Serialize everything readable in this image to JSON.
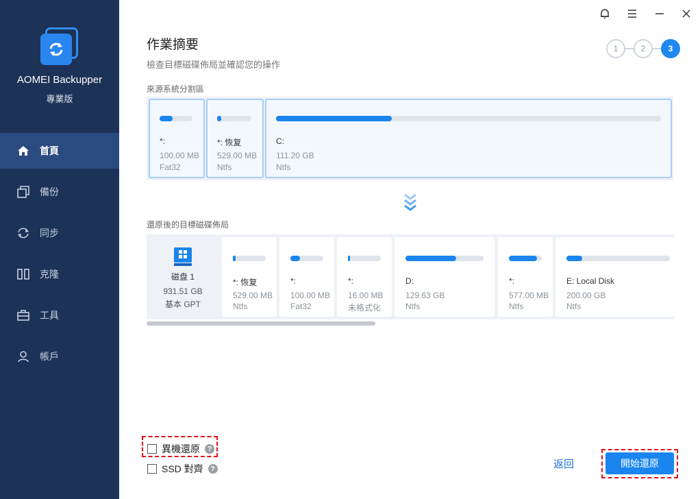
{
  "app": {
    "name": "AOMEI Backupper",
    "edition": "專業版"
  },
  "sidebar": {
    "items": [
      {
        "label": "首頁",
        "icon": "home-icon",
        "active": true
      },
      {
        "label": "備份",
        "icon": "backup-icon",
        "active": false
      },
      {
        "label": "同步",
        "icon": "sync-icon",
        "active": false
      },
      {
        "label": "克隆",
        "icon": "clone-icon",
        "active": false
      },
      {
        "label": "工具",
        "icon": "toolbox-icon",
        "active": false
      },
      {
        "label": "帳戶",
        "icon": "user-icon",
        "active": false
      }
    ]
  },
  "window_controls": [
    "bell-icon",
    "menu-icon",
    "minimize-icon",
    "close-icon"
  ],
  "page": {
    "title": "作業摘要",
    "subtitle": "檢查目標磁碟佈局並確認您的操作"
  },
  "steps": [
    "1",
    "2",
    "3"
  ],
  "active_step": 3,
  "source": {
    "label": "來源系統分割區",
    "partitions": [
      {
        "name": "*:",
        "size": "100.00 MB",
        "fs": "Fat32",
        "used_fraction": 0.4
      },
      {
        "name": "*: 恢复",
        "size": "529.00 MB",
        "fs": "Ntfs",
        "used_fraction": 0.12
      },
      {
        "name": "C:",
        "size": "111.20 GB",
        "fs": "Ntfs",
        "used_fraction": 0.3
      }
    ]
  },
  "target": {
    "label": "還原後的目標磁碟佈局",
    "disk": {
      "name": "磁盘 1",
      "size": "931.51 GB",
      "type": "基本 GPT"
    },
    "partitions": [
      {
        "name": "*: 恢复",
        "size": "529.00 MB",
        "fs": "Ntfs",
        "used_fraction": 0.08
      },
      {
        "name": "*:",
        "size": "100.00 MB",
        "fs": "Fat32",
        "used_fraction": 0.3
      },
      {
        "name": "*:",
        "size": "16.00 MB",
        "fs": "未格式化",
        "used_fraction": 0.06
      },
      {
        "name": "D:",
        "size": "129.63 GB",
        "fs": "Ntfs",
        "used_fraction": 0.65
      },
      {
        "name": "*:",
        "size": "577.00 MB",
        "fs": "Ntfs",
        "used_fraction": 0.85
      },
      {
        "name": "E: Local Disk",
        "size": "200.00 GB",
        "fs": "Ntfs",
        "used_fraction": 0.15
      }
    ]
  },
  "options": {
    "universal_restore": "異機還原",
    "ssd_align": "SSD 對齊",
    "help_glyph": "?"
  },
  "buttons": {
    "back": "返回",
    "start": "開始還原"
  },
  "colors": {
    "sidebar": "#1c3257",
    "accent": "#1a85ee",
    "highlight": "#e0101a"
  }
}
